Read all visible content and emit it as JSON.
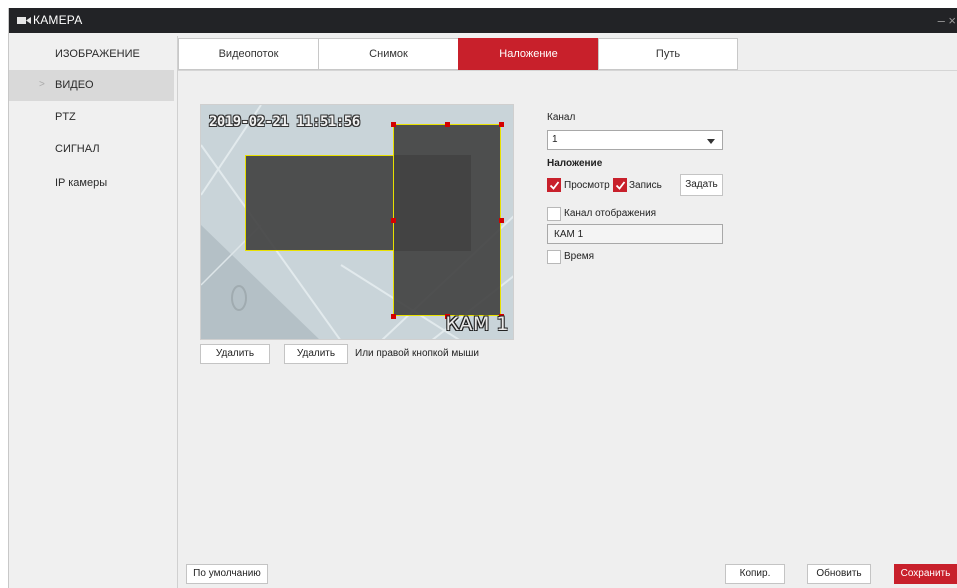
{
  "window": {
    "title": "КАМЕРА",
    "window_control": "– ×",
    "icon": "camera-icon"
  },
  "sidebar": {
    "items": [
      {
        "label": "ИЗОБРАЖЕНИЕ"
      },
      {
        "label": "ВИДЕО",
        "active": true
      },
      {
        "label": "PTZ"
      },
      {
        "label": "СИГНАЛ"
      },
      {
        "label": "IP камеры"
      }
    ]
  },
  "tabs": [
    {
      "label": "Видеопоток"
    },
    {
      "label": "Снимок"
    },
    {
      "label": "Наложение",
      "active": true
    },
    {
      "label": "Путь"
    }
  ],
  "preview": {
    "timestamp": "2019-02-21 11:51:56",
    "osd_name": "КАМ 1",
    "delete1": "Удалить",
    "delete2": "Удалить",
    "hint": "Или правой кнопкой мыши"
  },
  "settings": {
    "channel_label": "Канал",
    "channel_value": "1",
    "overlay_label": "Наложение",
    "preview_label": "Просмотр",
    "preview_checked": true,
    "record_label": "Запись",
    "record_checked": true,
    "set_button": "Задать",
    "channel_display_label": "Канал отображения",
    "channel_display_checked": false,
    "channel_name_value": "КАМ 1",
    "time_label": "Время",
    "time_checked": false
  },
  "footer": {
    "default_button": "По умолчанию",
    "copy_button": "Копир.",
    "refresh_button": "Обновить",
    "save_button": "Сохранить"
  },
  "colors": {
    "accent": "#c8202b",
    "titlebar": "#222326",
    "selection": "#e8e000"
  }
}
